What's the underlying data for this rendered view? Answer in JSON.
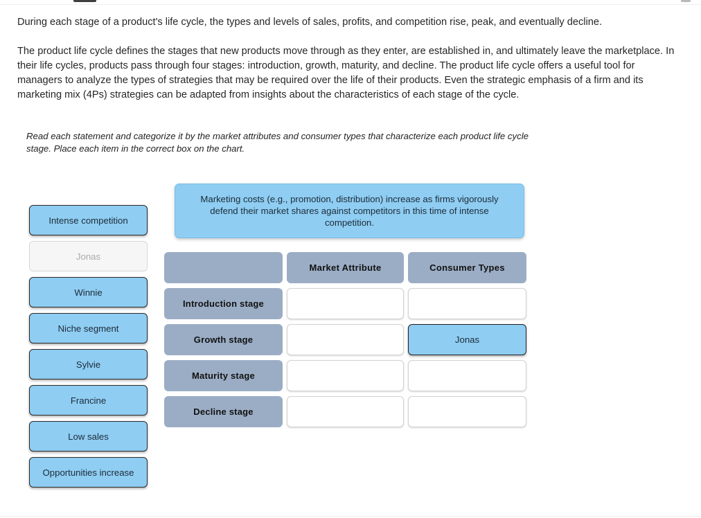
{
  "article": {
    "lead": "During each stage of a product's life cycle, the types and levels of sales, profits, and competition rise, peak, and eventually decline.",
    "body": "The product life cycle defines the stages that new products move through as they enter, are established in, and ultimately leave the marketplace. In their life cycles, products pass through four stages: introduction, growth, maturity, and decline. The product life cycle offers a useful tool for managers to analyze the types of strategies that may be required over the life of their products. Even the strategic emphasis of a firm and its marketing mix (4Ps) strategies can be adapted from insights about the characteristics of each stage of the cycle."
  },
  "instructions": "Read each statement and categorize it by the market attributes and consumer types that characterize each product life cycle stage. Place each item in the correct box on the chart.",
  "banner": {
    "text": "Marketing costs (e.g., promotion, distribution) increase as firms vigorously defend their market shares against competitors in this time of intense competition."
  },
  "palette": {
    "items": [
      {
        "label": "Intense competition",
        "state": "available"
      },
      {
        "label": "Jonas",
        "state": "placed"
      },
      {
        "label": "Winnie",
        "state": "available"
      },
      {
        "label": "Niche segment",
        "state": "available"
      },
      {
        "label": "Sylvie",
        "state": "available"
      },
      {
        "label": "Francine",
        "state": "available"
      },
      {
        "label": "Low sales",
        "state": "available"
      },
      {
        "label": "Opportunities increase",
        "state": "available"
      }
    ]
  },
  "matrix": {
    "corner_label": "",
    "columns": [
      "Market Attribute",
      "Consumer Types"
    ],
    "rows": [
      {
        "stage": "Introduction stage",
        "market_attribute": "",
        "consumer_types": ""
      },
      {
        "stage": "Growth stage",
        "market_attribute": "",
        "consumer_types": "Jonas"
      },
      {
        "stage": "Maturity stage",
        "market_attribute": "",
        "consumer_types": ""
      },
      {
        "stage": "Decline stage",
        "market_attribute": "",
        "consumer_types": ""
      }
    ]
  },
  "colors": {
    "chip_blue": "#8fcdf2",
    "header_blue_gray": "#9badc5",
    "placeholder_gray": "#f6f6f6",
    "text_dark": "#1c2b38"
  }
}
